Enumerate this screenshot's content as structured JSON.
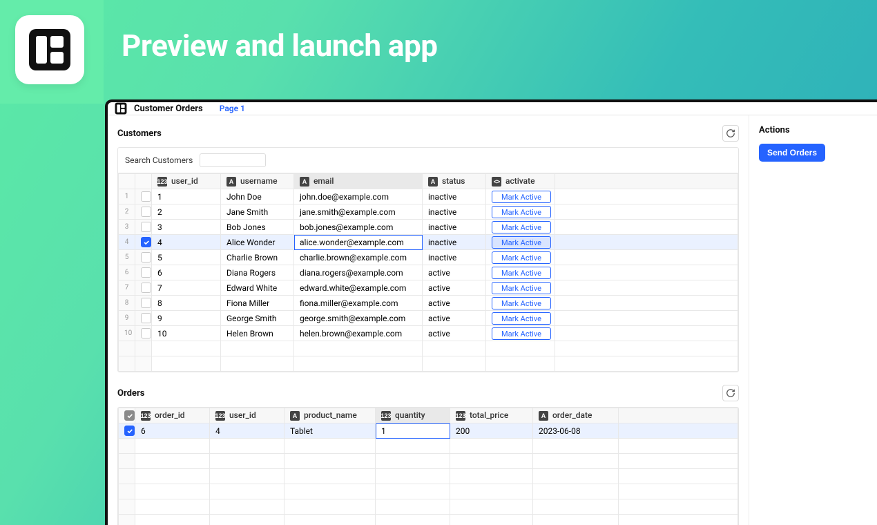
{
  "hero": {
    "title": "Preview and launch app"
  },
  "titlebar": {
    "app_name": "Customer Orders",
    "page_link": "Page 1"
  },
  "actions": {
    "title": "Actions",
    "send_orders": "Send Orders"
  },
  "customers": {
    "title": "Customers",
    "search_label": "Search Customers",
    "columns": {
      "user_id": "user_id",
      "username": "username",
      "email": "email",
      "status": "status",
      "activate": "activate"
    },
    "action_label": "Mark Active",
    "selected_index": 3,
    "editing_col": "email",
    "rows": [
      {
        "n": 1,
        "user_id": "1",
        "username": "John Doe",
        "email": "john.doe@example.com",
        "status": "inactive"
      },
      {
        "n": 2,
        "user_id": "2",
        "username": "Jane Smith",
        "email": "jane.smith@example.com",
        "status": "inactive"
      },
      {
        "n": 3,
        "user_id": "3",
        "username": "Bob Jones",
        "email": "bob.jones@example.com",
        "status": "inactive"
      },
      {
        "n": 4,
        "user_id": "4",
        "username": "Alice Wonder",
        "email": "alice.wonder@example.com",
        "status": "inactive"
      },
      {
        "n": 5,
        "user_id": "5",
        "username": "Charlie Brown",
        "email": "charlie.brown@example.com",
        "status": "inactive"
      },
      {
        "n": 6,
        "user_id": "6",
        "username": "Diana Rogers",
        "email": "diana.rogers@example.com",
        "status": "active"
      },
      {
        "n": 7,
        "user_id": "7",
        "username": "Edward White",
        "email": "edward.white@example.com",
        "status": "active"
      },
      {
        "n": 8,
        "user_id": "8",
        "username": "Fiona Miller",
        "email": "fiona.miller@example.com",
        "status": "active"
      },
      {
        "n": 9,
        "user_id": "9",
        "username": "George Smith",
        "email": "george.smith@example.com",
        "status": "active"
      },
      {
        "n": 10,
        "user_id": "10",
        "username": "Helen Brown",
        "email": "helen.brown@example.com",
        "status": "active"
      }
    ]
  },
  "orders": {
    "title": "Orders",
    "columns": {
      "order_id": "order_id",
      "user_id": "user_id",
      "product_name": "product_name",
      "quantity": "quantity",
      "total_price": "total_price",
      "order_date": "order_date"
    },
    "selected_index": 0,
    "editing_col": "quantity",
    "rows": [
      {
        "order_id": "6",
        "user_id": "4",
        "product_name": "Tablet",
        "quantity": "1",
        "total_price": "200",
        "order_date": "2023-06-08"
      }
    ]
  },
  "icons": {
    "num": "123",
    "text": "A",
    "code": "<>"
  }
}
